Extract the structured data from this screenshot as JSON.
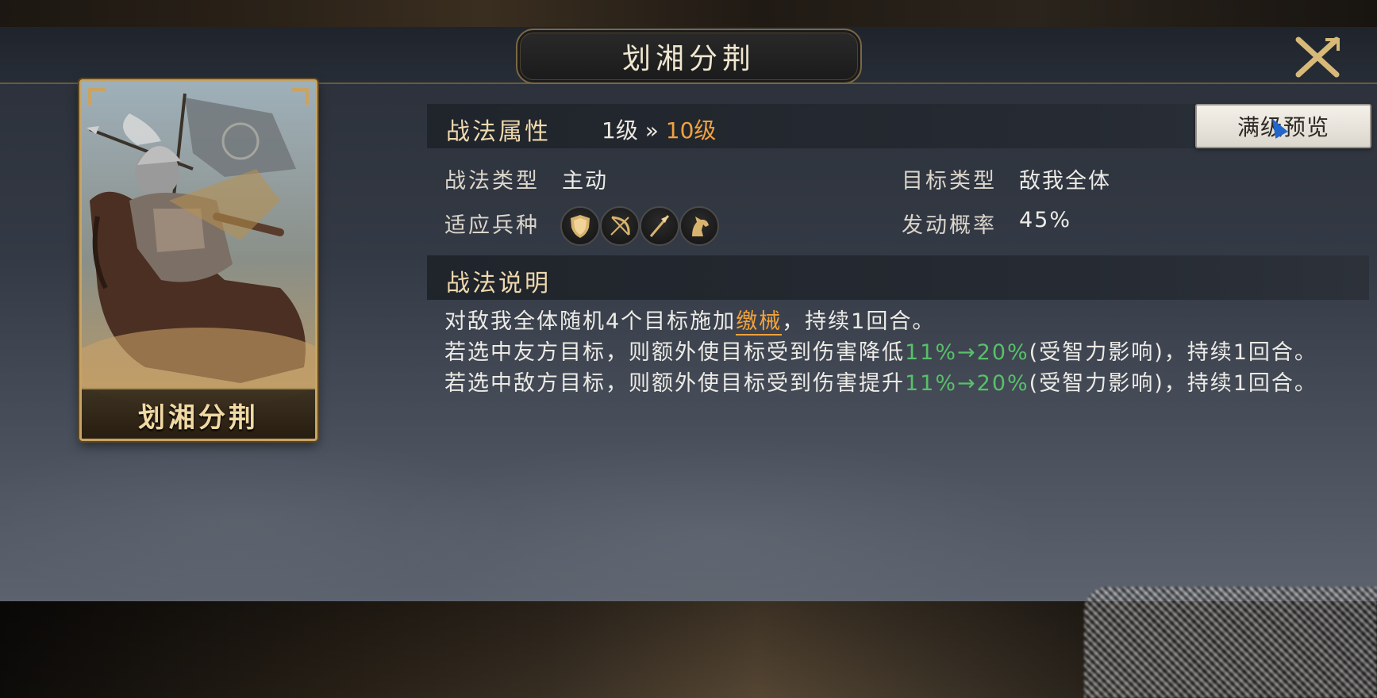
{
  "dialog": {
    "title": "划湘分荆",
    "close_icon": "close-x-icon"
  },
  "card": {
    "name": "划湘分荆",
    "portrait": "armored-general-on-horse-illustration"
  },
  "attributes": {
    "section_title": "战法属性",
    "level_from": "1级",
    "level_arrow": "»",
    "level_to": "10级",
    "full_preview_button": "满级预览",
    "tactic_type_label": "战法类型",
    "tactic_type_value": "主动",
    "target_type_label": "目标类型",
    "target_type_value": "敌我全体",
    "troop_label": "适应兵种",
    "troop_icons": [
      "shield-icon",
      "bow-icon",
      "spear-icon",
      "horse-icon"
    ],
    "trigger_rate_label": "发动概率",
    "trigger_rate_value": "45%"
  },
  "description": {
    "section_title": "战法说明",
    "line1_a": "对敌我全体随机4个目标施加",
    "line1_keyword": "缴械",
    "line1_b": "，持续1回合。",
    "line2_a": "若选中友方目标，则额外使目标受到伤害降低",
    "line2_value": "11%→20%",
    "line2_b": "(受智力影响)，持续1回合。",
    "line3_a": "若选中敌方目标，则额外使目标受到伤害提升",
    "line3_value": "11%→20%",
    "line3_b": "(受智力影响)，持续1回合。"
  },
  "colors": {
    "accent_gold": "#efd9ad",
    "level_max": "#f0a13f",
    "keyword": "#f2a23a",
    "value_green": "#58c06a"
  }
}
